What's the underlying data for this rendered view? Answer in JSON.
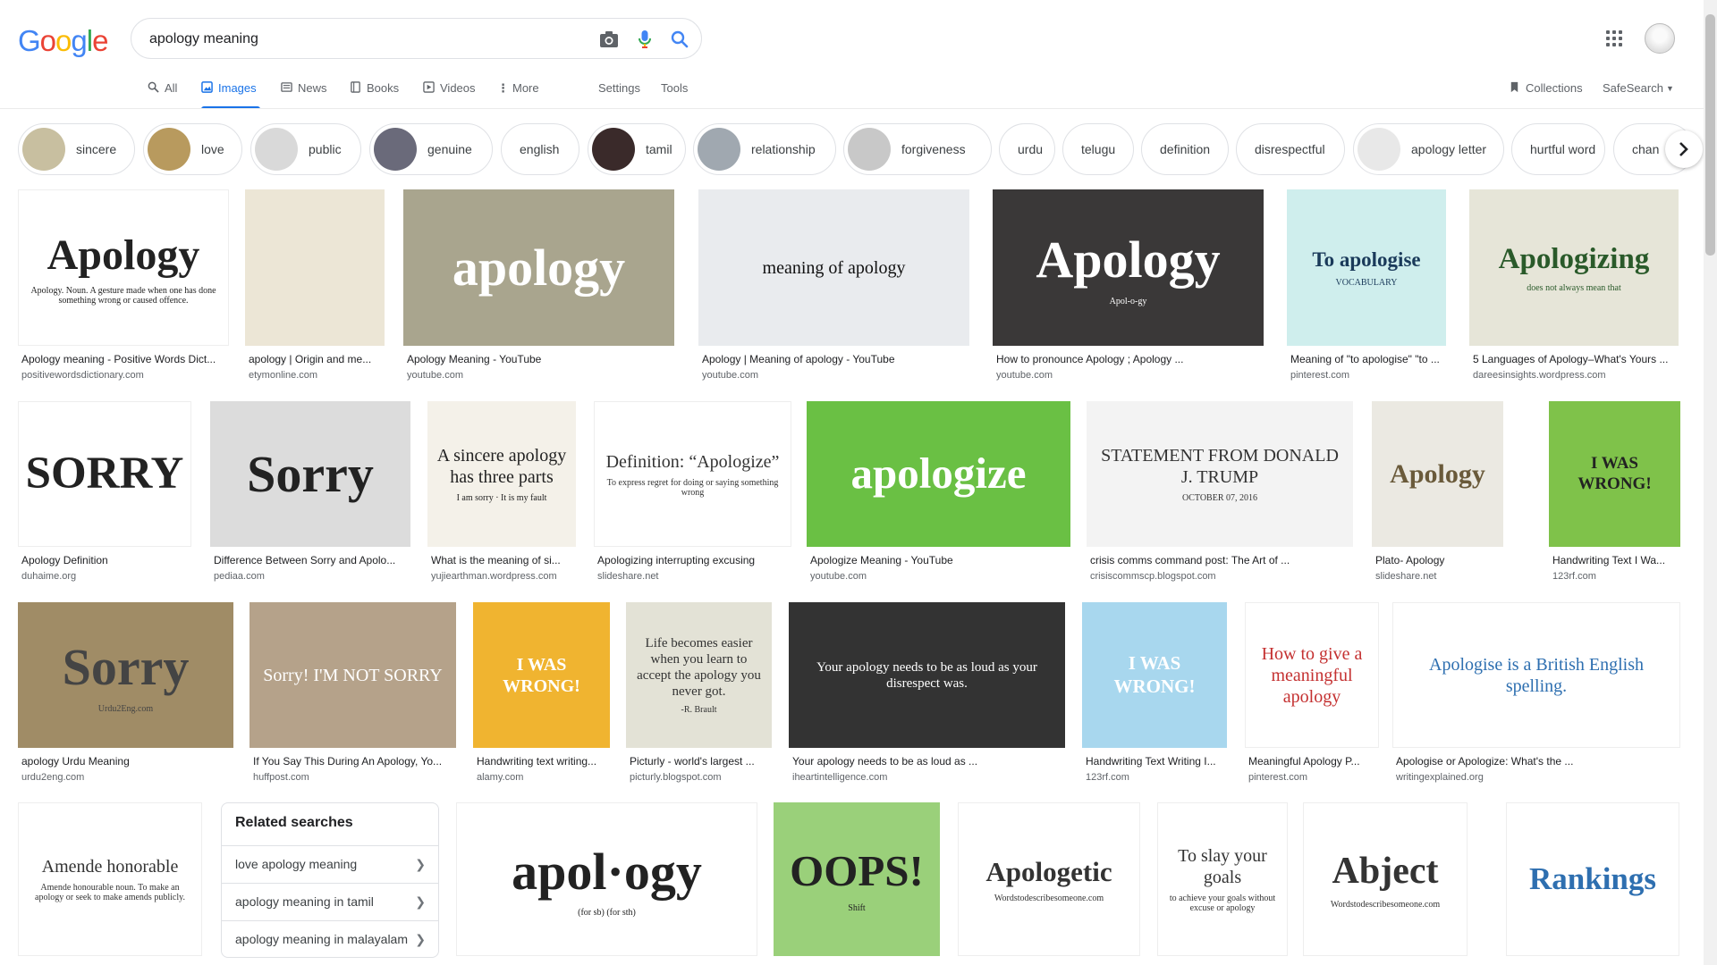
{
  "logo": [
    "G",
    "o",
    "o",
    "g",
    "l",
    "e"
  ],
  "logo_colors": [
    "#4285f4",
    "#ea4335",
    "#fbbc05",
    "#4285f4",
    "#34a853",
    "#ea4335"
  ],
  "search": {
    "query": "apology meaning"
  },
  "tabs": [
    {
      "label": "All",
      "icon": "search-icon",
      "active": false
    },
    {
      "label": "Images",
      "icon": "image-icon",
      "active": true
    },
    {
      "label": "News",
      "icon": "news-icon",
      "active": false
    },
    {
      "label": "Books",
      "icon": "book-icon",
      "active": false
    },
    {
      "label": "Videos",
      "icon": "video-icon",
      "active": false
    },
    {
      "label": "More",
      "icon": "more-vert-icon",
      "active": false
    }
  ],
  "tools": {
    "settings": "Settings",
    "tools": "Tools",
    "collections": "Collections",
    "safesearch": "SafeSearch"
  },
  "chips": [
    {
      "label": "sincere",
      "thumb": true,
      "color": "#c8bfa0"
    },
    {
      "label": "love",
      "thumb": true,
      "color": "#b89a5e"
    },
    {
      "label": "public",
      "thumb": true,
      "color": "#d9d9d9"
    },
    {
      "label": "genuine",
      "thumb": true,
      "color": "#6a6a7a"
    },
    {
      "label": "english",
      "thumb": false
    },
    {
      "label": "tamil",
      "thumb": true,
      "color": "#3a2a2a"
    },
    {
      "label": "relationship",
      "thumb": true,
      "color": "#a0a8b0"
    },
    {
      "label": "forgiveness",
      "thumb": true,
      "color": "#c8c8c8"
    },
    {
      "label": "urdu",
      "thumb": false
    },
    {
      "label": "telugu",
      "thumb": false
    },
    {
      "label": "definition",
      "thumb": false
    },
    {
      "label": "disrespectful",
      "thumb": false
    },
    {
      "label": "apology letter",
      "thumb": true,
      "color": "#e8e8e8"
    },
    {
      "label": "hurtful word",
      "thumb": false
    },
    {
      "label": "chan",
      "thumb": false
    }
  ],
  "results": [
    {
      "caption": "Apology meaning - Positive Words Dict...",
      "source": "positivewordsdictionary.com",
      "bg": "#ffffff",
      "fg": "#222222",
      "text": "Apology",
      "sub": "Apology. Noun. A gesture made when one has done something wrong or caused offence."
    },
    {
      "caption": "apology | Origin and me...",
      "source": "etymonline.com",
      "bg": "#ece6d6",
      "fg": "#777777",
      "text": "",
      "sub": ""
    },
    {
      "caption": "Apology Meaning - YouTube",
      "source": "youtube.com",
      "bg": "#a9a58e",
      "fg": "#ffffff",
      "text": "apology",
      "sub": ""
    },
    {
      "caption": "Apology | Meaning of apology - YouTube",
      "source": "youtube.com",
      "bg": "#e9ebee",
      "fg": "#111111",
      "text": "meaning of apology",
      "sub": ""
    },
    {
      "caption": "How to pronounce Apology ; Apology ...",
      "source": "youtube.com",
      "bg": "#3a3838",
      "fg": "#ffffff",
      "text": "Apology",
      "sub": "Apol-o-gy"
    },
    {
      "caption": "Meaning of \"to apologise\" \"to ...",
      "source": "pinterest.com",
      "bg": "#cfeeed",
      "fg": "#1a3a5a",
      "text": "To apologise",
      "sub": "VOCABULARY"
    },
    {
      "caption": "5 Languages of Apology–What's Yours ...",
      "source": "dareesinsights.wordpress.com",
      "bg": "#e6e5d8",
      "fg": "#2a5a2a",
      "text": "Apologizing",
      "sub": "does not always mean that"
    },
    {
      "caption": "Apology Definition",
      "source": "duhaime.org",
      "bg": "#ffffff",
      "fg": "#222222",
      "text": "SORRY",
      "sub": ""
    },
    {
      "caption": "Difference Between Sorry and Apolo...",
      "source": "pediaa.com",
      "bg": "#dcdcdc",
      "fg": "#222222",
      "text": "Sorry",
      "sub": ""
    },
    {
      "caption": "What is the meaning of si...",
      "source": "yujiearthman.wordpress.com",
      "bg": "#f4f1e9",
      "fg": "#222222",
      "text": "A sincere apology has three parts",
      "sub": "I am sorry · It is my fault"
    },
    {
      "caption": "Apologizing interrupting excusing",
      "source": "slideshare.net",
      "bg": "#ffffff",
      "fg": "#333333",
      "text": "Definition: “Apologize”",
      "sub": "To express regret for doing or saying something wrong"
    },
    {
      "caption": "Apologize Meaning - YouTube",
      "source": "youtube.com",
      "bg": "#6ac044",
      "fg": "#ffffff",
      "text": "apologize",
      "sub": ""
    },
    {
      "caption": "crisis comms command post: The Art of ...",
      "source": "crisiscommscp.blogspot.com",
      "bg": "#f3f3f3",
      "fg": "#333333",
      "text": "STATEMENT FROM DONALD J. TRUMP",
      "sub": "OCTOBER 07, 2016"
    },
    {
      "caption": "Plato- Apology",
      "source": "slideshare.net",
      "bg": "#ebe9e2",
      "fg": "#6a5a3a",
      "text": "Apology",
      "sub": ""
    },
    {
      "caption": "Handwriting Text I Wa...",
      "source": "123rf.com",
      "bg": "#7fc24a",
      "fg": "#222222",
      "text": "I WAS WRONG!",
      "sub": ""
    },
    {
      "caption": "apology Urdu Meaning",
      "source": "urdu2eng.com",
      "bg": "#a08c66",
      "fg": "#444444",
      "text": "Sorry",
      "sub": "Urdu2Eng.com"
    },
    {
      "caption": "If You Say This During An Apology, Yo...",
      "source": "huffpost.com",
      "bg": "#b5a28a",
      "fg": "#ffffff",
      "text": "Sorry! I'M NOT SORRY",
      "sub": ""
    },
    {
      "caption": "Handwriting text writing...",
      "source": "alamy.com",
      "bg": "#f0b430",
      "fg": "#ffffff",
      "text": "I WAS WRONG!",
      "sub": ""
    },
    {
      "caption": "Picturly - world's largest ...",
      "source": "picturly.blogspot.com",
      "bg": "#e3e2d6",
      "fg": "#333333",
      "text": "Life becomes easier when you learn to accept the apology you never got.",
      "sub": "-R. Brault"
    },
    {
      "caption": "Your apology needs to be as loud as ...",
      "source": "iheartintelligence.com",
      "bg": "#333333",
      "fg": "#ffffff",
      "text": "Your apology needs to be as loud as your disrespect was.",
      "sub": ""
    },
    {
      "caption": "Handwriting Text Writing I...",
      "source": "123rf.com",
      "bg": "#a8d7ee",
      "fg": "#ffffff",
      "text": "I WAS WRONG!",
      "sub": ""
    },
    {
      "caption": "Meaningful Apology P...",
      "source": "pinterest.com",
      "bg": "#ffffff",
      "fg": "#c43030",
      "text": "How to give a meaningful apology",
      "sub": ""
    },
    {
      "caption": "Apologise or Apologize: What's the ...",
      "source": "writingexplained.org",
      "bg": "#ffffff",
      "fg": "#2e6fb0",
      "text": "Apologise is a British English spelling.",
      "sub": ""
    },
    {
      "caption": "",
      "source": "",
      "bg": "#ffffff",
      "fg": "#333333",
      "text": "Amende honorable",
      "sub": "Amende honourable noun. To make an apology or seek to make amends publicly."
    },
    {
      "caption": "",
      "source": "",
      "bg": "#ffffff",
      "fg": "#222222",
      "text": "apol·ogy",
      "sub": "(for sb) (for sth)"
    },
    {
      "caption": "",
      "source": "",
      "bg": "#9ad07a",
      "fg": "#222222",
      "text": "OOPS!",
      "sub": "Shift"
    },
    {
      "caption": "",
      "source": "",
      "bg": "#ffffff",
      "fg": "#333333",
      "text": "Apologetic",
      "sub": "Wordstodescribesomeone.com"
    },
    {
      "caption": "",
      "source": "",
      "bg": "#ffffff",
      "fg": "#333333",
      "text": "To slay your goals",
      "sub": "to achieve your goals without excuse or apology"
    },
    {
      "caption": "",
      "source": "",
      "bg": "#ffffff",
      "fg": "#333333",
      "text": "Abject",
      "sub": "Wordstodescribesomeone.com"
    },
    {
      "caption": "",
      "source": "",
      "bg": "#ffffff",
      "fg": "#2e6fb0",
      "text": "Rankings",
      "sub": ""
    }
  ],
  "related": {
    "title": "Related searches",
    "items": [
      "love apology meaning",
      "apology meaning in tamil",
      "apology meaning in malayalam"
    ]
  }
}
